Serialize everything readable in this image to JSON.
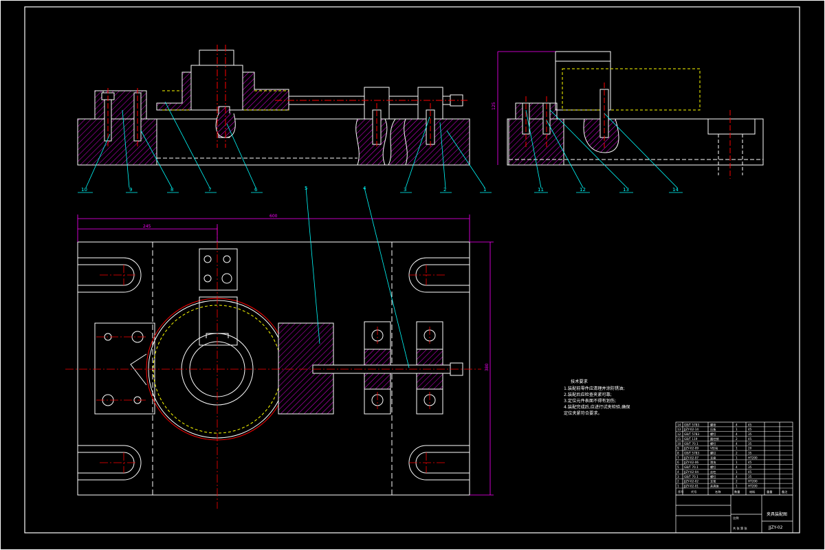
{
  "colors": {
    "background": "#000000",
    "outline": "#ffffff",
    "centerline": "#ff0000",
    "hatch": "#ff00ff",
    "dimension": "#ff00ff",
    "leader": "#00ffff",
    "hidden_part": "#ffff00"
  },
  "balloons": {
    "b1": "1",
    "b2": "2",
    "b3": "3",
    "b4": "4",
    "b5": "5",
    "b6": "6",
    "b7": "7",
    "b8": "8",
    "b9": "9",
    "b10": "10",
    "b11": "11",
    "b12": "12",
    "b13": "13",
    "b14": "14"
  },
  "dimensions": {
    "side_height": "125",
    "top_left_offset": "245",
    "overall_width": "600",
    "overall_height": "380"
  },
  "technical_requirements": {
    "title": "技术要求",
    "lines": [
      "1.装配前零件应清理并涂防锈油;",
      "2.装配后应检查夹紧可靠;",
      "3.定位元件表面不得有划伤;",
      "4.装配完成后,应进行试夹检验,确保"
    ],
    "continuation": "定位夹紧符合要求。"
  },
  "title_block": {
    "bom_rows": [
      {
        "no": "14",
        "code": "GB/T 5783",
        "name": "螺栓",
        "qty": "4",
        "material": "45"
      },
      {
        "no": "13",
        "code": "JJZY-02-14",
        "name": "压板",
        "qty": "1",
        "material": "45"
      },
      {
        "no": "12",
        "code": "GB/T 5783",
        "name": "螺钉",
        "qty": "4",
        "material": "35"
      },
      {
        "no": "11",
        "code": "GB/T 119",
        "name": "圆柱销",
        "qty": "2",
        "material": "45"
      },
      {
        "no": "10",
        "code": "GB/T 70.1",
        "name": "螺钉",
        "qty": "4",
        "material": "35"
      },
      {
        "no": "9",
        "code": "JJZY-02-09",
        "name": "V形块",
        "qty": "1",
        "material": "20"
      },
      {
        "no": "8",
        "code": "GB/T 5783",
        "name": "螺钉",
        "qty": "2",
        "material": "35"
      },
      {
        "no": "7",
        "code": "JJZY-02-07",
        "name": "支座",
        "qty": "1",
        "material": "HT200"
      },
      {
        "no": "6",
        "code": "JJZY-02-06",
        "name": "滑块",
        "qty": "1",
        "material": "45"
      },
      {
        "no": "5",
        "code": "GB/T 70.1",
        "name": "螺钉",
        "qty": "4",
        "material": "35"
      },
      {
        "no": "4",
        "code": "JJZY-02-04",
        "name": "丝杠",
        "qty": "1",
        "material": "45"
      },
      {
        "no": "3",
        "code": "GB/T 70.1",
        "name": "螺钉",
        "qty": "4",
        "material": "35"
      },
      {
        "no": "2",
        "code": "JJZY-02-02",
        "name": "支架",
        "qty": "2",
        "material": "HT200"
      },
      {
        "no": "1",
        "code": "JJZY-02-01",
        "name": "夹具体",
        "qty": "1",
        "material": "HT200"
      }
    ],
    "header": {
      "no": "序号",
      "code": "代号",
      "name": "名称",
      "qty": "数量",
      "material": "材料",
      "weight": "重量",
      "note": "备注"
    },
    "drawing_name": "夹具装配图",
    "drawing_number": "JJZY-02",
    "scale_label": "比例",
    "sheet_label": "共 张 第 张"
  }
}
